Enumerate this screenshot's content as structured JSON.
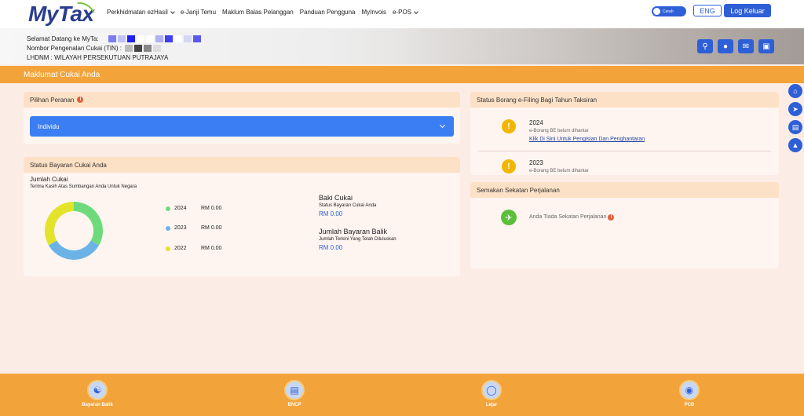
{
  "nav": {
    "logo_text": "MyTax",
    "menu": [
      {
        "label": "Perkhidmatan ezHasil",
        "dropdown": true
      },
      {
        "label": "e-Janji Temu",
        "dropdown": false
      },
      {
        "label": "Maklum Balas Pelanggan",
        "dropdown": false
      },
      {
        "label": "Panduan Pengguna",
        "dropdown": false
      },
      {
        "label": "MyInvois",
        "dropdown": false
      },
      {
        "label": "e-POS",
        "dropdown": true
      }
    ],
    "toggle_label": "Cerah",
    "lang_label": "ENG",
    "logout_label": "Log Keluar",
    "accent_color": "#2f5fd6"
  },
  "banner": {
    "welcome": "Selamat Datang ke MyTa:",
    "tin_label": "Nombor Pengenalan Cukai (TIN) :",
    "branch": "LHDNM : WILAYAH PERSEKUTUAN PUTRAJAYA",
    "icons": [
      "search-icon",
      "user-icon",
      "mail-icon",
      "calculator-icon"
    ]
  },
  "page": {
    "title": "Maklumat Cukai Anda",
    "orange_color": "#f2a33a"
  },
  "side_icons": [
    "home-icon",
    "megaphone-icon",
    "book-icon",
    "graduation-cap-icon"
  ],
  "role_card": {
    "title": "Pilihan Peranan",
    "info_icon": "i",
    "selected_role": "Individu"
  },
  "payment_card": {
    "title": "Status Bayaran Cukai Anda",
    "subtitle": "Jumlah Cukai",
    "thanks": "Terima Kasih Atas Sumbangan Anda Untuk Negara",
    "legend": [
      {
        "year": "2024",
        "amount": "RM 0.00",
        "color": "#6ddb7b"
      },
      {
        "year": "2023",
        "amount": "RM 0.00",
        "color": "#6bb3e6"
      },
      {
        "year": "2022",
        "amount": "RM 0.00",
        "color": "#e3e32a"
      }
    ],
    "balance_title": "Baki Cukai",
    "balance_sub": "Status Bayaran Cukai Anda",
    "balance_amount": "RM 0.00",
    "refund_title": "Jumlah Bayaran Balik",
    "refund_sub": "Jumlah Terkini Yang Telah Diluluskan",
    "refund_amount": "RM 0.00"
  },
  "chart_data": {
    "type": "pie",
    "categories": [
      "2024",
      "2023",
      "2022"
    ],
    "values": [
      1,
      1,
      1
    ],
    "colors": [
      "#6ddb7b",
      "#6bb3e6",
      "#e3e32a"
    ],
    "donut": true,
    "legend_position": "right"
  },
  "efiling_card": {
    "title": "Status Borang e-Filing Bagi Tahun Taksiran",
    "items": [
      {
        "year": "2024",
        "status": "e-Borang BE belum dihantar",
        "link": "Klik Di Sini Untuk Pengisian Dan Penghantaran",
        "icon": "warning-icon",
        "color": "#f2b500"
      },
      {
        "year": "2023",
        "status": "e-Borang BE belum dihantar",
        "icon": "warning-icon",
        "color": "#f2b500"
      }
    ]
  },
  "travel_card": {
    "title": "Semakan Sekatan Perjalanan",
    "status": "Anda Tiada Sekatan Perjalanan",
    "icon": "airplane-icon",
    "icon_color": "#5bbf3a"
  },
  "bottom_nav": [
    {
      "label": "Bayaran Balik",
      "icon": "refund-icon"
    },
    {
      "label": "BNCP",
      "icon": "document-icon"
    },
    {
      "label": "Lejar",
      "icon": "ledger-icon"
    },
    {
      "label": "PCB",
      "icon": "coins-icon"
    }
  ]
}
